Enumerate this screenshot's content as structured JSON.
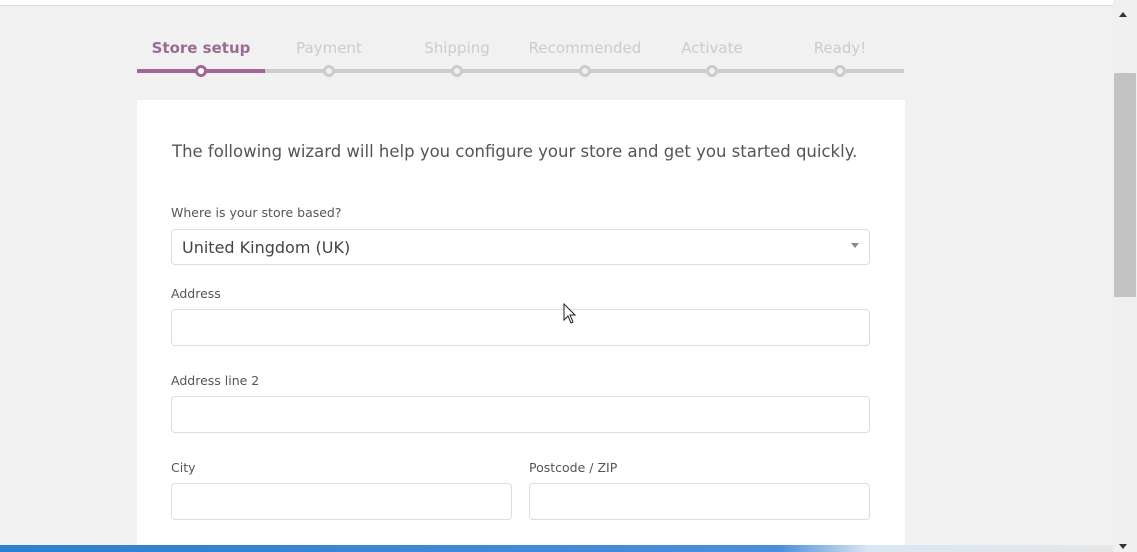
{
  "steps": [
    {
      "label": "Store setup",
      "active": true
    },
    {
      "label": "Payment",
      "active": false
    },
    {
      "label": "Shipping",
      "active": false
    },
    {
      "label": "Recommended",
      "active": false
    },
    {
      "label": "Activate",
      "active": false
    },
    {
      "label": "Ready!",
      "active": false
    }
  ],
  "intro": "The following wizard will help you configure your store and get you started quickly.",
  "form": {
    "country_label": "Where is your store based?",
    "country_value": "United Kingdom (UK)",
    "address_label": "Address",
    "address_value": "",
    "address2_label": "Address line 2",
    "address2_value": "",
    "city_label": "City",
    "city_value": "",
    "postcode_label": "Postcode / ZIP",
    "postcode_value": ""
  },
  "colors": {
    "accent": "#a46497",
    "inactive": "#cccccc"
  }
}
